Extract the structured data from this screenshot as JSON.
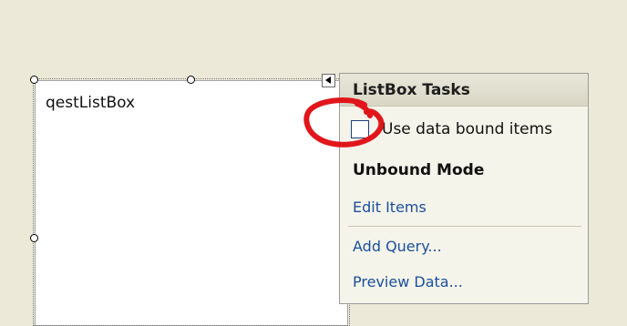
{
  "designer": {
    "listbox": {
      "item_text": "qestListBox"
    }
  },
  "tasks_panel": {
    "title": "ListBox Tasks",
    "checkbox_label": "Use data bound items",
    "checkbox_checked": false,
    "section_title": "Unbound Mode",
    "links": {
      "edit_items": "Edit Items",
      "add_query": "Add Query...",
      "preview_data": "Preview Data..."
    }
  },
  "annotation": {
    "color": "#E0161B"
  },
  "colors": {
    "background": "#ECE9D8",
    "panel": "#F5F4EA",
    "link": "#1B4F9C"
  }
}
